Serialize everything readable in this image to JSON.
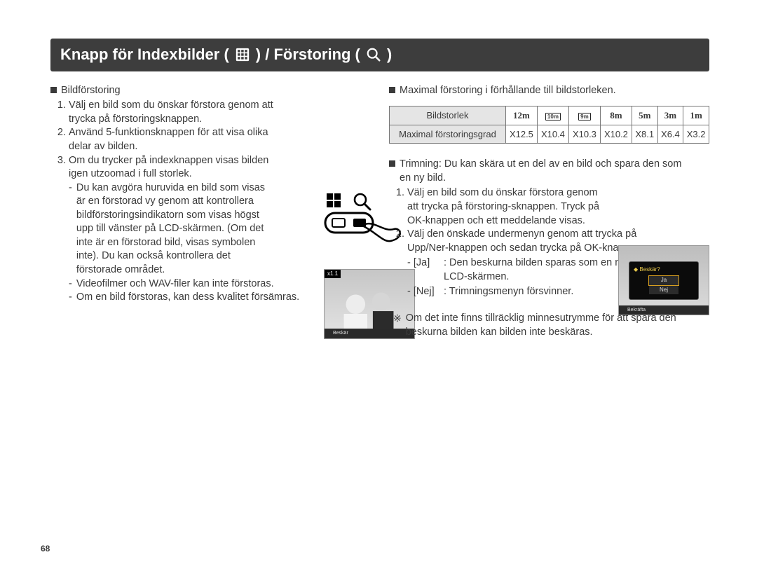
{
  "page_number": "68",
  "title": {
    "pre": "Knapp för Indexbilder (",
    "mid": ") / Förstoring (",
    "post": ")"
  },
  "left": {
    "heading": "Bildförstoring",
    "steps": [
      "Välj en bild som du önskar förstora genom att trycka på förstoringsknappen.",
      "Använd 5-funktionsknappen för att visa olika delar av bilden.",
      "Om du trycker på indexknappen visas bilden igen utzoomad i full storlek."
    ],
    "sub": [
      "Du kan avgöra huruvida en bild som visas är en förstorad vy genom att kontrollera bildförstoringsindikatorn som visas högst upp till vänster på LCD-skärmen. (Om det inte är en förstorad bild, visas symbolen inte). Du kan också kontrollera det förstorade området.",
      "Videofilmer och WAV-filer kan inte förstoras.",
      "Om en bild förstoras, kan dess kvalitet försämras."
    ],
    "thumb": {
      "zoom_badge": "x1.1",
      "footer": "Beskär"
    }
  },
  "right": {
    "heading": "Maximal förstoring i förhållande till bildstorleken.",
    "table": {
      "row1_label": "Bildstorlek",
      "row2_label": "Maximal förstoringsgrad",
      "sizes": [
        "12m",
        "10m",
        "9m",
        "8m",
        "5m",
        "3m",
        "1m"
      ],
      "zoom": [
        "X12.5",
        "X10.4",
        "X10.3",
        "X10.2",
        "X8.1",
        "X6.4",
        "X3.2"
      ]
    },
    "trim_heading": "Trimning: Du kan skära ut en del av en bild och spara den som en ny bild.",
    "trim_steps": [
      "Välj en bild som du önskar förstora genom att trycka på förstoring-sknappen. Tryck på OK-knappen och ett meddelande visas.",
      "Välj den önskade undermenyn genom att trycka på Upp/Ner-knappen och sedan trycka på OK-knappen."
    ],
    "trim_defs": [
      {
        "k": "- [Ja]",
        "v": ": Den beskurna bilden sparas som en ny fil och visas på LCD-skärmen."
      },
      {
        "k": "- [Nej]",
        "v": ": Trimningsmenyn försvinner."
      }
    ],
    "note": "Om det inte finns tillräcklig minnesutrymme för att spara den beskurna bilden kan bilden inte beskäras.",
    "thumb": {
      "dlg_title": "Beskär?",
      "opt1": "Ja",
      "opt2": "Nej",
      "footer": "Bekräfta"
    }
  }
}
